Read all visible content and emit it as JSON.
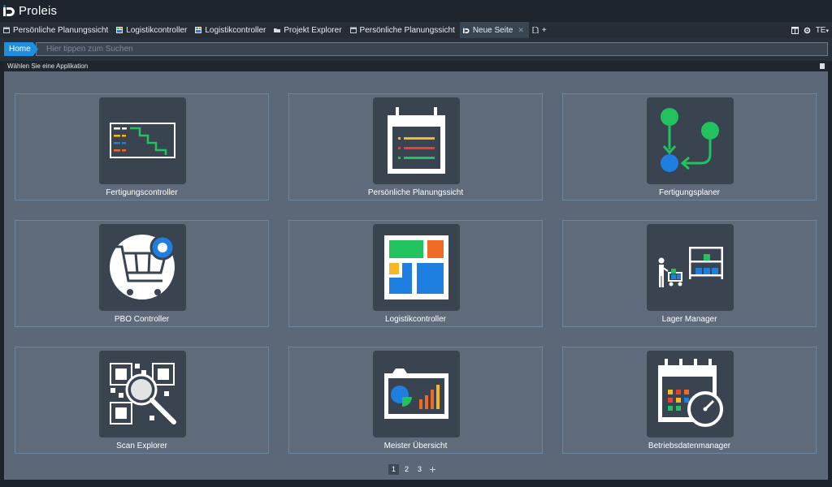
{
  "app": {
    "title": "Proleis"
  },
  "tabs": [
    {
      "label": "Persönliche Planungssicht",
      "icon": "calendar-icon",
      "color": "#9aa6b2"
    },
    {
      "label": "Logistikcontroller",
      "icon": "logistics-icon",
      "color": "#4aa3e6"
    },
    {
      "label": "Logistikcontroller",
      "icon": "logistics-icon",
      "color": "#4aa3e6"
    },
    {
      "label": "Projekt Explorer",
      "icon": "folder-icon",
      "color": "#d8dde2"
    },
    {
      "label": "Persönliche Planungssicht",
      "icon": "calendar-icon",
      "color": "#9aa6b2"
    },
    {
      "label": "Neue Seite",
      "icon": "proleis-icon",
      "active": true
    }
  ],
  "tab_add": "+",
  "tab_right": {
    "user": "TE"
  },
  "nav": {
    "home_label": "Home",
    "search_placeholder": "Hier tippen zum Suchen"
  },
  "section": {
    "title": "Wählen Sie eine Applikation"
  },
  "apps": [
    {
      "label": "Fertigungscontroller",
      "icon": "production-controller-icon"
    },
    {
      "label": "Persönliche Planungssicht",
      "icon": "calendar-list-icon"
    },
    {
      "label": "Fertigungsplaner",
      "icon": "flow-planner-icon"
    },
    {
      "label": "PBO Controller",
      "icon": "shopping-cart-icon"
    },
    {
      "label": "Logistikcontroller",
      "icon": "logistics-blocks-icon"
    },
    {
      "label": "Lager Manager",
      "icon": "warehouse-worker-icon"
    },
    {
      "label": "Scan Explorer",
      "icon": "qr-magnifier-icon"
    },
    {
      "label": "Meister Übersicht",
      "icon": "dashboard-chart-icon"
    },
    {
      "label": "Betriebsdatenmanager",
      "icon": "calendar-clock-icon"
    }
  ],
  "pager": {
    "pages": [
      "1",
      "2",
      "3"
    ],
    "active": "1",
    "add": "+"
  },
  "colors": {
    "accent": "#1e8fe0",
    "green": "#22c35e",
    "orange": "#f06a28",
    "yellow": "#f5b820",
    "red": "#e8422e",
    "blue": "#1e7fe0"
  }
}
